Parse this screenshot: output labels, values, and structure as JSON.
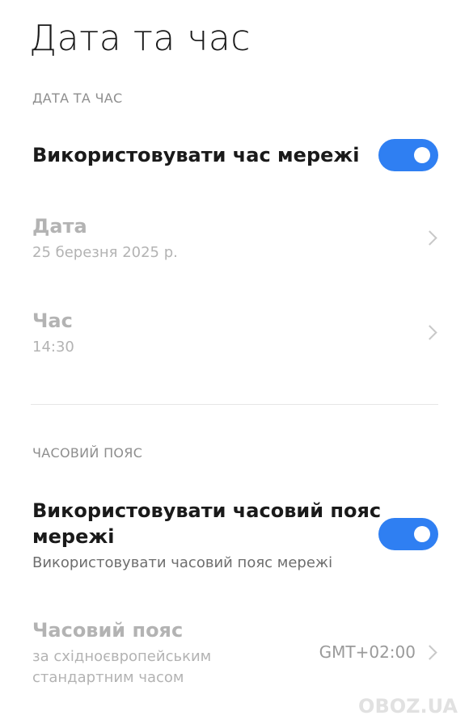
{
  "page": {
    "title": "Дата та час"
  },
  "section_datetime": {
    "header": "ДАТА ТА ЧАС",
    "network_time": {
      "label": "Використовувати час мережі",
      "enabled": true
    },
    "date": {
      "label": "Дата",
      "value": "25 березня 2025 р."
    },
    "time": {
      "label": "Час",
      "value": "14:30"
    }
  },
  "section_timezone": {
    "header": "ЧАСОВИЙ ПОЯС",
    "network_timezone": {
      "label_line1": "Використовувати часовий пояс",
      "label_line2": "мережі",
      "description": "Використовувати часовий пояс мережі",
      "enabled": true
    },
    "timezone": {
      "label": "Часовий пояс",
      "desc_line1": "за східноєвропейським",
      "desc_line2": "стандартним часом",
      "value": "GMT+02:00"
    }
  },
  "watermark": {
    "text": "OBOZ.UA"
  },
  "colors": {
    "accent": "#2f7ff2",
    "disabled_text": "#b3b3b3",
    "section_header": "#8e8e8e"
  },
  "icons": {
    "chevron": "chevron-right-icon",
    "toggle_knob": "toggle-knob"
  }
}
